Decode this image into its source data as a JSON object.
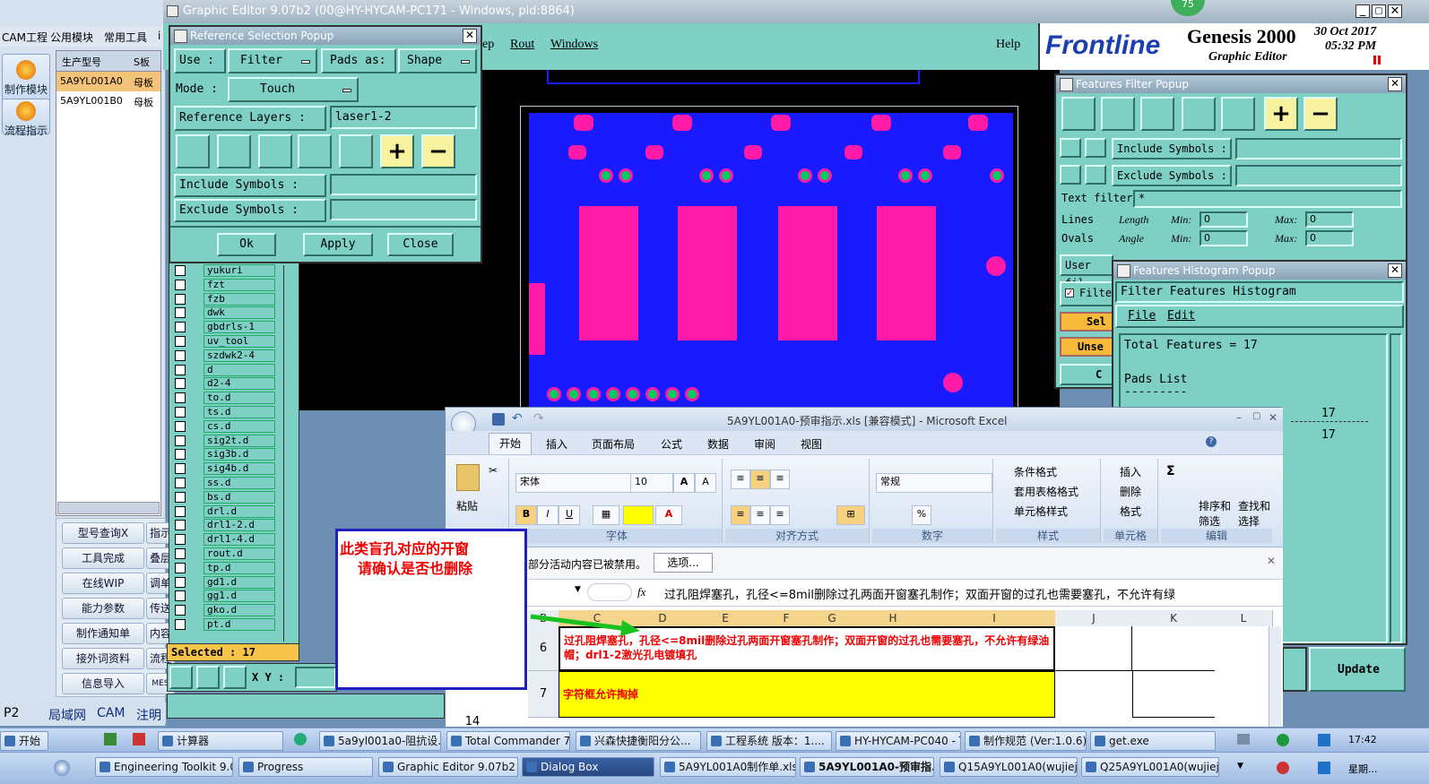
{
  "cam": {
    "menu": [
      "CAM工程",
      "公用模块",
      "常用工具",
      "i"
    ],
    "side_buttons": [
      "制作模块",
      "流程指示"
    ],
    "table_headers": [
      "生产型号",
      "S板"
    ],
    "rows": [
      [
        "5A9YL001A0",
        "母板"
      ],
      [
        "5A9YL001B0",
        "母板"
      ]
    ],
    "buttons": [
      "型号查询X",
      "工具完成",
      "在线WIP",
      "能力参数",
      "制作通知单",
      "接外词资料",
      "信息导入"
    ],
    "buttons_right": [
      "指示",
      "叠层",
      "调单",
      "传送",
      "内容",
      "流程",
      "MES"
    ],
    "status": [
      "P2",
      "局域网",
      "CAM",
      "注明"
    ]
  },
  "ge": {
    "title": "Graphic Editor 9.07b2 (00@HY-HYCAM-PC171 - Windows, pid:8864)",
    "menu": [
      "ep",
      "Rout",
      "Windows",
      "Help"
    ],
    "brand": "Frontline",
    "product": "Genesis 2000",
    "subtitle": "Graphic Editor",
    "date": "30 Oct 2017",
    "time": "05:32 PM",
    "badge": "75",
    "selected": "Selected : 17",
    "xy_label": "X Y :",
    "layers": [
      "yukuri",
      "fzt",
      "fzb",
      "dwk",
      "gbdrls-1",
      "uv_tool",
      "szdwk2-4",
      "d",
      "d2-4",
      "to.d",
      "ts.d",
      "cs.d",
      "sig2t.d",
      "sig3b.d",
      "sig4b.d",
      "ss.d",
      "bs.d",
      "drl.d",
      "drl1-2.d",
      "drl1-4.d",
      "rout.d",
      "tp.d",
      "gd1.d",
      "gg1.d",
      "gko.d",
      "pt.d"
    ]
  },
  "ref_popup": {
    "title": "Reference Selection Popup",
    "use_label": "Use  :",
    "use_value": "Filter",
    "pads_as_label": "Pads as:",
    "pads_as_value": "Shape",
    "mode_label": "Mode :",
    "mode_value": "Touch",
    "ref_layers_label": "Reference Layers :",
    "ref_layers_value": "laser1-2",
    "include_label": "Include Symbols :",
    "exclude_label": "Exclude Symbols :",
    "ok": "Ok",
    "apply": "Apply",
    "close": "Close"
  },
  "ff_popup": {
    "title": "Features Filter Popup",
    "include_label": "Include Symbols :",
    "exclude_label": "Exclude Symbols :",
    "text_filter_label": "Text filter",
    "text_filter_value": "*",
    "lines": "Lines",
    "ovals": "Ovals",
    "length": "Length",
    "angle": "Angle",
    "min": "Min:",
    "max": "Max:",
    "min_val": "0",
    "max_val": "0",
    "user_fil": "User fil",
    "filter": "Filter",
    "sel": "Sel",
    "unse": "Unse",
    "c": "C",
    "update": "Update"
  },
  "hist_popup": {
    "title": "Features Histogram Popup",
    "heading": "Filter Features Histogram",
    "menu": [
      "File",
      "Edit"
    ],
    "total": "Total Features = 17",
    "pads_list": "Pads List",
    "dashes": "---------",
    "count1": "17",
    "count2": "17"
  },
  "excel": {
    "title": "5A9YL001A0-预审指示.xls  [兼容模式] - Microsoft Excel",
    "tabs": [
      "开始",
      "插入",
      "页面布局",
      "公式",
      "数据",
      "审阅",
      "视图"
    ],
    "font_name": "宋体",
    "font_size": "10",
    "number_format": "常规",
    "paste": "粘贴",
    "groups": [
      "字体",
      "对齐方式",
      "数字",
      "样式",
      "单元格",
      "编辑"
    ],
    "style_items": [
      "条件格式",
      "套用表格格式",
      "单元格样式"
    ],
    "cell_items": [
      "插入",
      "删除",
      "格式"
    ],
    "edit_items": [
      "排序和筛选",
      "查找和选择"
    ],
    "warning": "部分活动内容已被禁用。",
    "options": "选项...",
    "fx": "fx",
    "formula": "过孔阻焊塞孔，孔径<=8mil删除过孔两面开窗塞孔制作；双面开窗的过孔也需要塞孔，不允许有绿",
    "columns": [
      "B",
      "C",
      "D",
      "E",
      "F",
      "G",
      "H",
      "I",
      "J",
      "K",
      "L"
    ],
    "rows": [
      {
        "num": "6",
        "text": "过孔阻焊塞孔，孔径<=8mil删除过孔两面开窗塞孔制作；双面开窗的过孔也需要塞孔，不允许有绿油帽；drl1-2激光孔电镀填孔"
      },
      {
        "num": "7",
        "text": "字符框允许掏掉"
      },
      {
        "num": "14",
        "text": ""
      }
    ]
  },
  "note": {
    "line1": "此类盲孔对应的开窗",
    "line2": "请确认是否也删除"
  },
  "taskbar": {
    "start": "开始",
    "row1": [
      "计算器",
      "5a9yl001a0-阻抗设...",
      "Total Commander 7.0...",
      "兴森快捷衡阳分公...",
      "工程系统  版本：1....",
      "HY-HYCAM-PC040 - T...",
      "制作规范 (Ver:1.0.6)",
      "get.exe"
    ],
    "row2": [
      "Engineering Toolkit 9.07...",
      "Progress",
      "Graphic Editor 9.07b2 (0...",
      "Dialog Box",
      "5A9YL001A0制作单.xls ...",
      "5A9YL001A0-预审指...",
      "Q15A9YL001A0(wujiejun...",
      "Q25A9YL001A0(wujieju..."
    ],
    "clock": "17:42",
    "weekday": "星期..."
  }
}
